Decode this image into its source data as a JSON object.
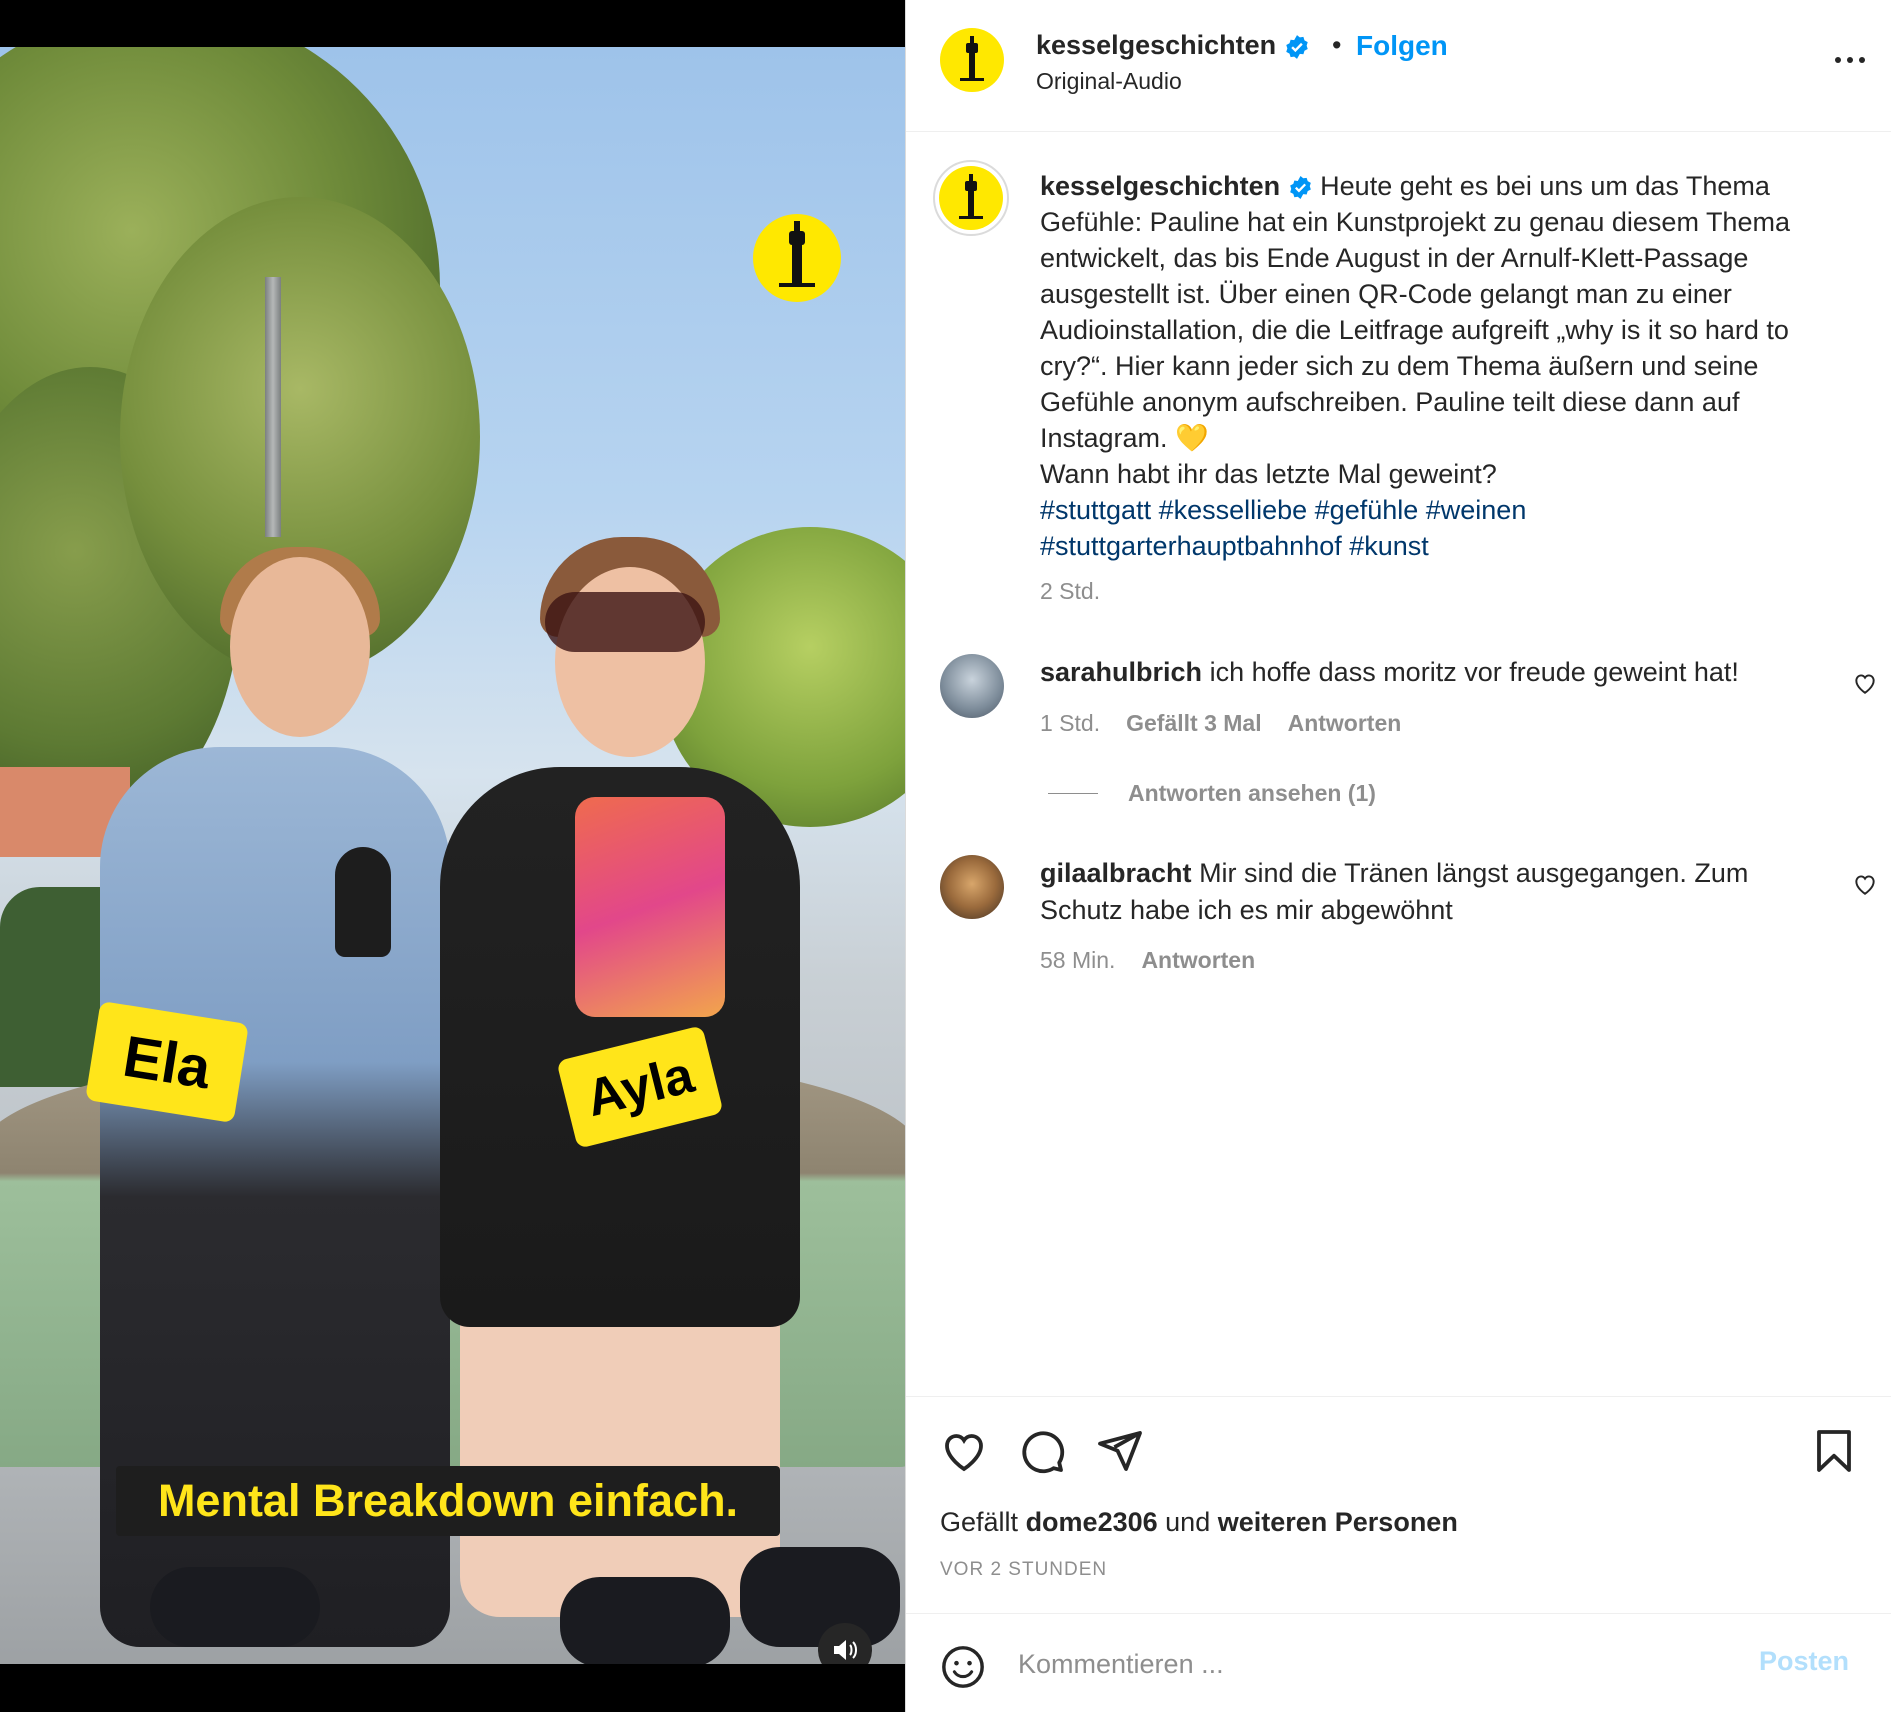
{
  "post": {
    "username": "kesselgeschichten",
    "verified": true,
    "separator": "•",
    "follow_label": "Folgen",
    "audio_label": "Original-Audio",
    "more_icon": "more-horizontal-icon"
  },
  "video": {
    "brand_badge_icon": "tv-tower-logo-icon",
    "name_tag_left": "Ela",
    "name_tag_right": "Ayla",
    "subtitle": "Mental Breakdown einfach.",
    "mute_icon": "speaker-icon"
  },
  "caption": {
    "username": "kesselgeschichten",
    "text": "Heute geht es bei uns um das Thema Gefühle: Pauline hat ein Kunstprojekt zu genau diesem Thema entwickelt, das bis Ende August in der Arnulf-Klett-Passage ausgestellt ist. Über einen QR-Code gelangt man zu einer Audioinstallation, die die Leitfrage aufgreift „why is it so hard to cry?“. Hier kann jeder sich zu dem Thema äußern und seine Gefühle anonym aufschreiben. Pauline teilt diese dann auf Instagram. 💛",
    "question": "Wann habt ihr das letzte Mal geweint?",
    "hashtags_line1": "#stuttgatt #kesselliebe #gefühle #weinen",
    "hashtags_line2": "#stuttgarterhauptbahnhof #kunst",
    "time": "2 Std."
  },
  "comments": [
    {
      "username": "sarahulbrich",
      "text": "ich hoffe dass moritz vor freude geweint hat!",
      "time": "1 Std.",
      "likes": "Gefällt 3 Mal",
      "reply": "Antworten",
      "view_replies": "Antworten ansehen (1)"
    },
    {
      "username": "gilaalbracht",
      "text": "Mir sind die Tränen längst ausgegangen. Zum Schutz habe ich es mir abgewöhnt",
      "time": "58 Min.",
      "reply": "Antworten"
    }
  ],
  "actions": {
    "like_icon": "heart-icon",
    "comment_icon": "comment-icon",
    "share_icon": "send-icon",
    "save_icon": "bookmark-icon",
    "likes_prefix": "Gefällt",
    "likes_user": "dome2306",
    "likes_mid": "und",
    "likes_suffix": "weiteren Personen",
    "post_age": "VOR 2 STUNDEN"
  },
  "comment_box": {
    "emoji_icon": "smiley-icon",
    "placeholder": "Kommentieren ...",
    "post_label": "Posten"
  },
  "colors": {
    "brand_yellow": "#ffe800",
    "link_blue": "#0095f6",
    "hashtag_blue": "#00376b",
    "muted_gray": "#8e8e8e",
    "disabled_blue": "#b2dffc"
  }
}
